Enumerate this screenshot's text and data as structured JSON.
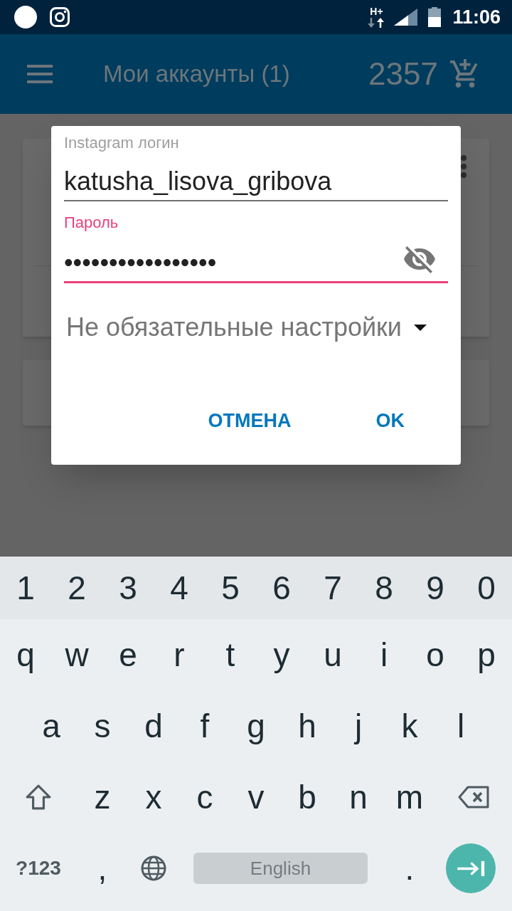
{
  "status_bar": {
    "network": "H+",
    "time": "11:06"
  },
  "app_bar": {
    "title": "Мои аккаунты (1)",
    "balance": "2357"
  },
  "dialog": {
    "fields": [
      {
        "kind": "text",
        "label": "Instagram логин",
        "value": "katusha_lisova_gribova",
        "focused": false
      },
      {
        "kind": "password",
        "label": "Пароль",
        "value": "•••••••••••••••••",
        "focused": true
      }
    ],
    "dropdown": {
      "label": "Не обязательные настройки"
    },
    "buttons": [
      "ОТМЕНА",
      "OK"
    ]
  },
  "keyboard": {
    "rows": [
      [
        "1",
        "2",
        "3",
        "4",
        "5",
        "6",
        "7",
        "8",
        "9",
        "0"
      ],
      [
        "q",
        "w",
        "e",
        "r",
        "t",
        "y",
        "u",
        "i",
        "o",
        "p"
      ],
      [
        "a",
        "s",
        "d",
        "f",
        "g",
        "h",
        "j",
        "k",
        "l"
      ],
      [
        "z",
        "x",
        "c",
        "v",
        "b",
        "n",
        "m"
      ]
    ],
    "symbols_key": "?123",
    "comma_key": ",",
    "space_key": "English",
    "period_key": "."
  }
}
